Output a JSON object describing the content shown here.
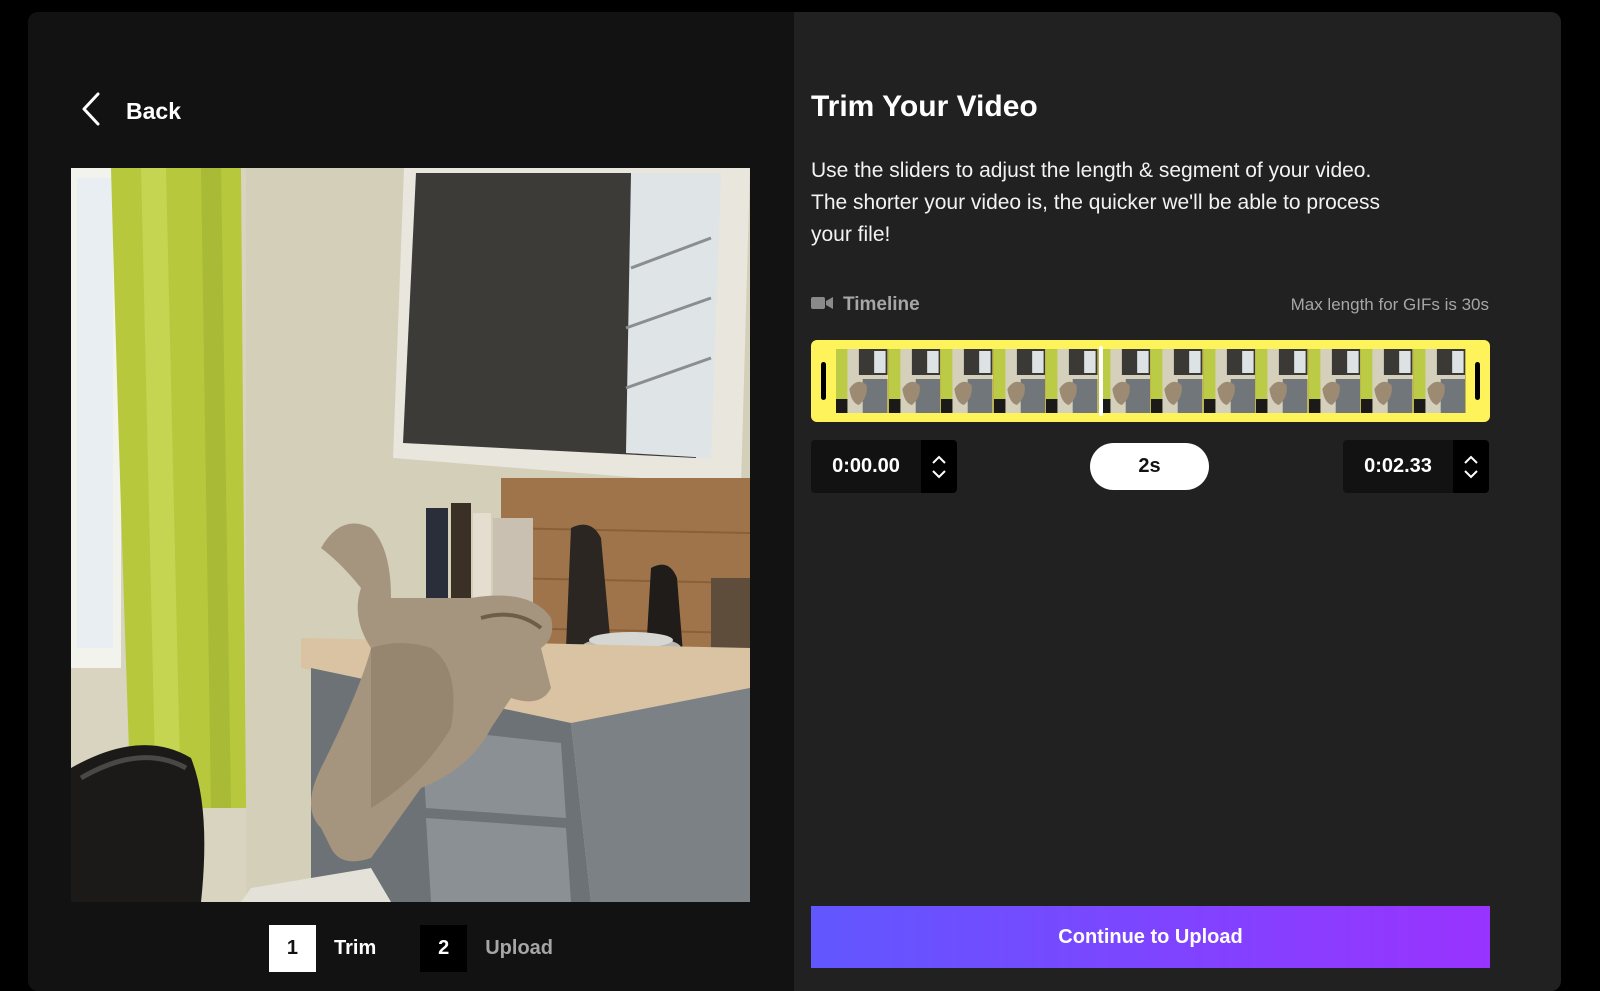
{
  "header": {
    "back_label": "Back"
  },
  "steps": [
    {
      "number": "1",
      "label": "Trim",
      "active": true
    },
    {
      "number": "2",
      "label": "Upload",
      "active": false
    }
  ],
  "panel": {
    "title": "Trim Your Video",
    "description": "Use the sliders to adjust the length & segment of your video. The shorter your video is, the quicker we'll be able to process your file!",
    "timeline_label": "Timeline",
    "max_length_note": "Max length for GIFs is 30s",
    "start_time": "0:00.00",
    "end_time": "0:02.33",
    "duration": "2s",
    "continue_label": "Continue to Upload"
  },
  "colors": {
    "accent_track": "#fff35c",
    "button_gradient_start": "#6157ff",
    "button_gradient_end": "#9933ff",
    "left_bg": "#121212",
    "right_bg": "#212121"
  },
  "icons": {
    "back": "chevron-left-icon",
    "timeline": "video-camera-icon",
    "increment": "chevron-up-icon",
    "decrement": "chevron-down-icon"
  }
}
